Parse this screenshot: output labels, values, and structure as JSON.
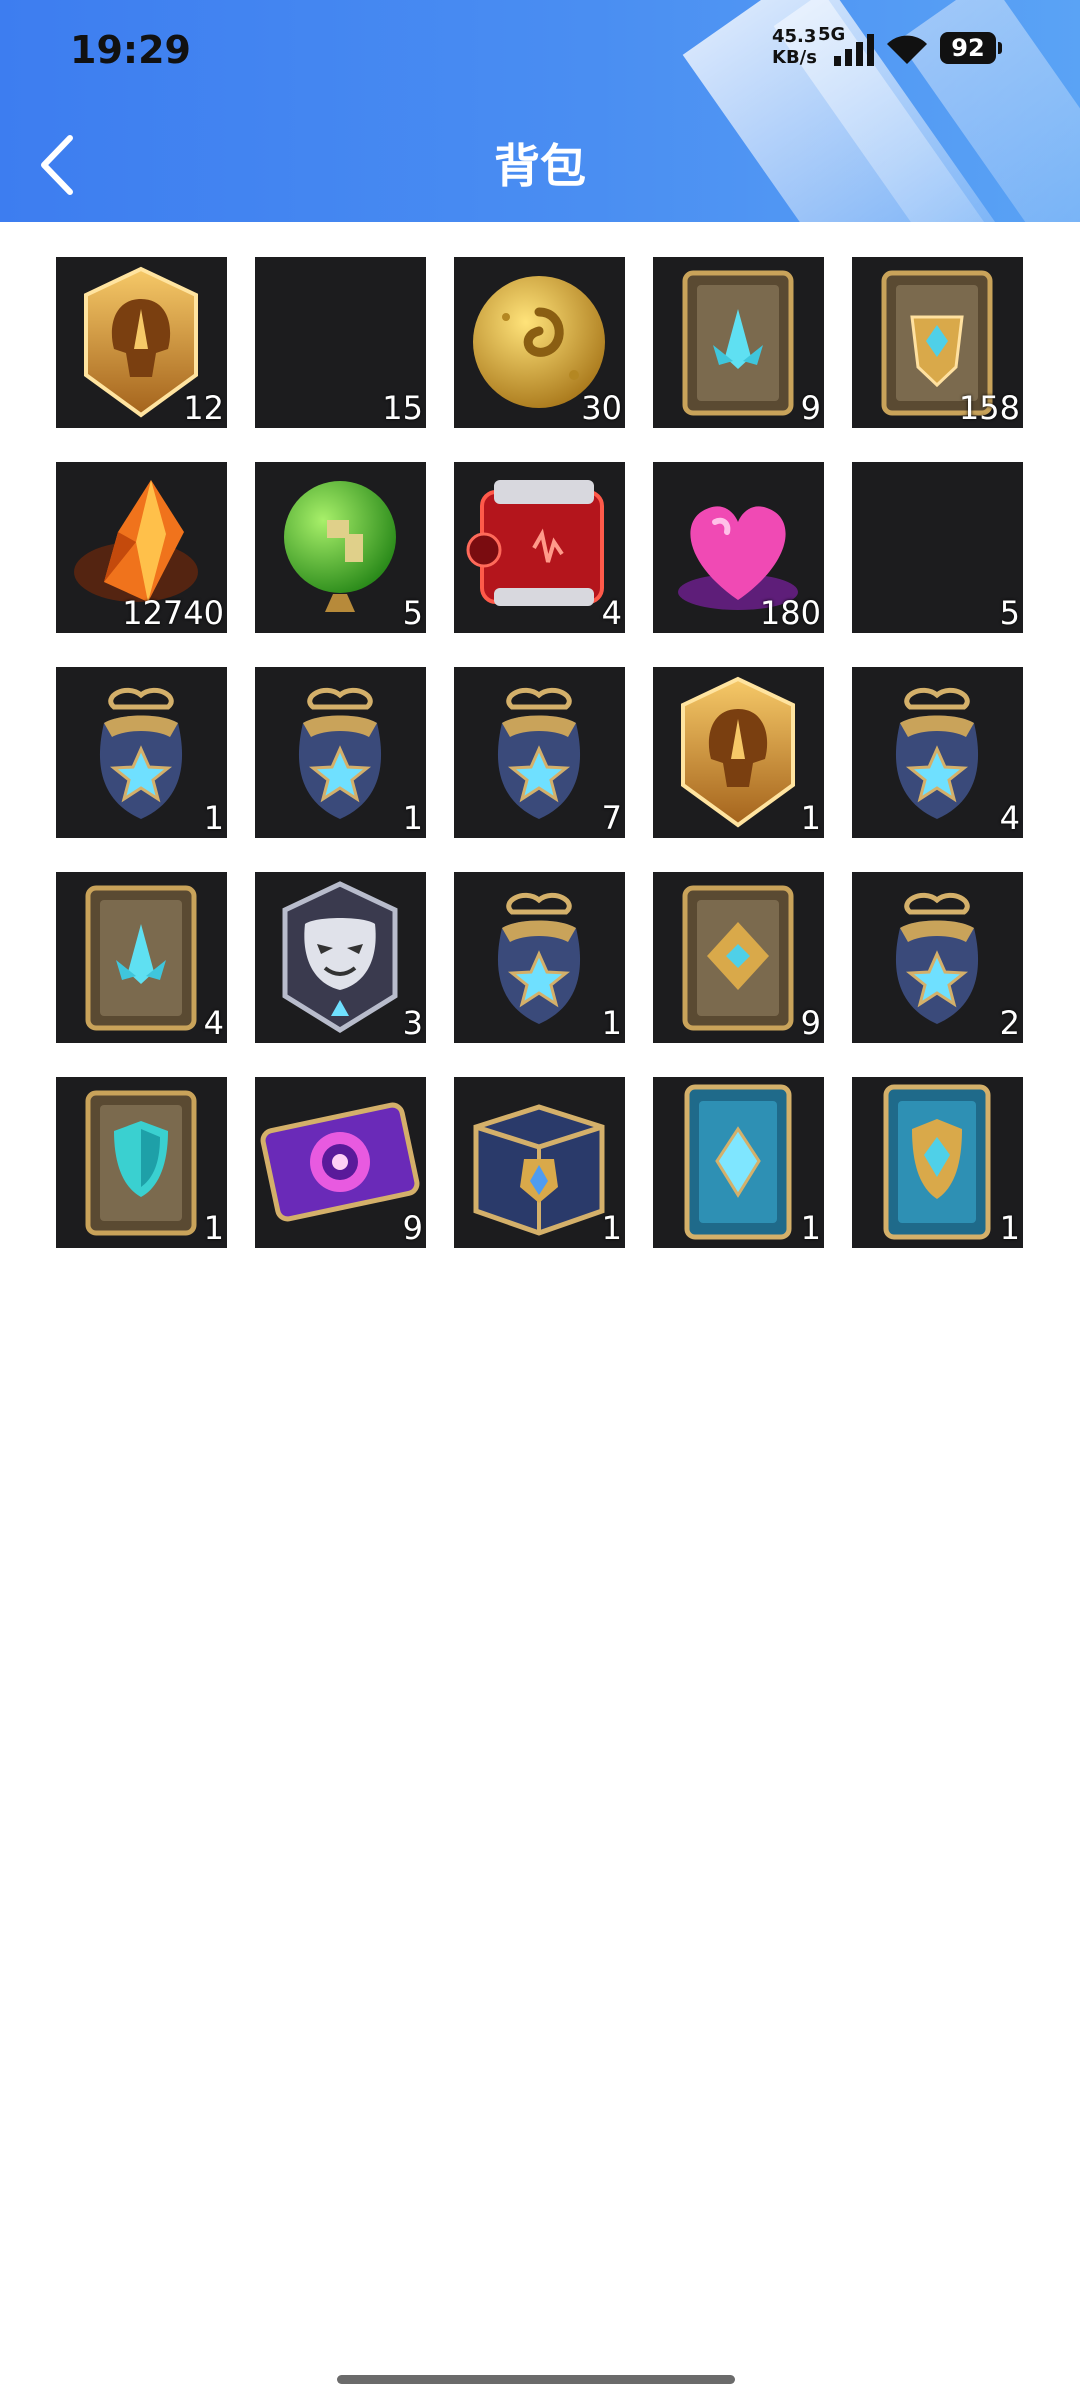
{
  "status_bar": {
    "time": "19:29",
    "net_speed_value": "45.3",
    "net_speed_unit": "KB/s",
    "network": "5G",
    "battery": "92"
  },
  "header": {
    "title": "背包",
    "back_icon": "chevron-left-icon",
    "colors": {
      "start": "#3d7df0",
      "end": "#5aa3f5"
    }
  },
  "inventory": {
    "items": [
      {
        "icon": "gold-helmet-emblem",
        "count": "12"
      },
      {
        "icon": "empty",
        "count": "15"
      },
      {
        "icon": "gold-coin",
        "count": "30"
      },
      {
        "icon": "blue-crystal-card",
        "count": "9"
      },
      {
        "icon": "gold-crest-card",
        "count": "158"
      },
      {
        "icon": "orange-essence-shard",
        "count": "12740"
      },
      {
        "icon": "green-orb",
        "count": "5"
      },
      {
        "icon": "red-capsule",
        "count": "4"
      },
      {
        "icon": "pink-heart",
        "count": "180"
      },
      {
        "icon": "empty",
        "count": "5"
      },
      {
        "icon": "star-pouch",
        "count": "1"
      },
      {
        "icon": "star-pouch",
        "count": "1"
      },
      {
        "icon": "star-pouch",
        "count": "7"
      },
      {
        "icon": "gold-helmet-emblem",
        "count": "1"
      },
      {
        "icon": "star-pouch",
        "count": "4"
      },
      {
        "icon": "blue-crystal-card",
        "count": "4"
      },
      {
        "icon": "mask-emblem",
        "count": "3"
      },
      {
        "icon": "star-pouch",
        "count": "1"
      },
      {
        "icon": "gold-diamond-card",
        "count": "9"
      },
      {
        "icon": "star-pouch",
        "count": "2"
      },
      {
        "icon": "teal-shield-card",
        "count": "1"
      },
      {
        "icon": "purple-eye-ticket",
        "count": "9"
      },
      {
        "icon": "blue-gold-chest",
        "count": "1"
      },
      {
        "icon": "blue-crystal-tall-card",
        "count": "1"
      },
      {
        "icon": "blue-shield-tall-card",
        "count": "1"
      }
    ]
  }
}
